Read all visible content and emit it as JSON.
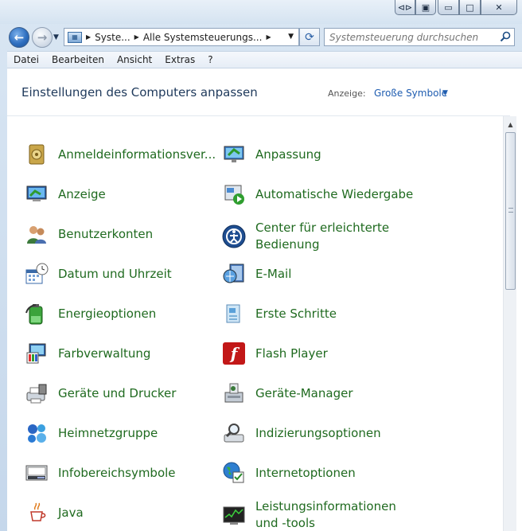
{
  "window": {
    "caption_buttons": [
      {
        "name": "minimize",
        "glyph": "▭"
      },
      {
        "name": "maximize",
        "glyph": "□"
      },
      {
        "name": "close",
        "glyph": "✕"
      }
    ],
    "extra_buttons": [
      "⊲⊳",
      "▣"
    ]
  },
  "nav": {
    "back_glyph": "←",
    "forward_glyph": "→",
    "breadcrumb": [
      "Syste...",
      "Alle Systemsteuerungs..."
    ],
    "refresh_glyph": "⟳",
    "search": {
      "placeholder": "Systemsteuerung durchsuchen"
    }
  },
  "menu": [
    "Datei",
    "Bearbeiten",
    "Ansicht",
    "Extras",
    "?"
  ],
  "header": {
    "title": "Einstellungen des Computers anpassen",
    "view_label": "Anzeige:",
    "view_value": "Große Symbole"
  },
  "items": [
    {
      "label": "Anmeldeinformationsver...",
      "icon": "credential-manager-icon"
    },
    {
      "label": "Anpassung",
      "icon": "personalization-icon"
    },
    {
      "label": "Anzeige",
      "icon": "display-icon"
    },
    {
      "label": "Automatische Wiedergabe",
      "icon": "autoplay-icon"
    },
    {
      "label": "Benutzerkonten",
      "icon": "user-accounts-icon"
    },
    {
      "label": "Center für erleichterte Bedienung",
      "icon": "ease-of-access-icon"
    },
    {
      "label": "Datum und Uhrzeit",
      "icon": "date-time-icon"
    },
    {
      "label": "E-Mail",
      "icon": "mail-icon"
    },
    {
      "label": "Energieoptionen",
      "icon": "power-options-icon"
    },
    {
      "label": "Erste Schritte",
      "icon": "getting-started-icon"
    },
    {
      "label": "Farbverwaltung",
      "icon": "color-management-icon"
    },
    {
      "label": "Flash Player",
      "icon": "flash-player-icon"
    },
    {
      "label": "Geräte und Drucker",
      "icon": "devices-printers-icon"
    },
    {
      "label": "Geräte-Manager",
      "icon": "device-manager-icon"
    },
    {
      "label": "Heimnetzgruppe",
      "icon": "homegroup-icon"
    },
    {
      "label": "Indizierungsoptionen",
      "icon": "indexing-options-icon"
    },
    {
      "label": "Infobereichsymbole",
      "icon": "notification-area-icon"
    },
    {
      "label": "Internetoptionen",
      "icon": "internet-options-icon"
    },
    {
      "label": "Java",
      "icon": "java-icon"
    },
    {
      "label": "Leistungsinformationen und -tools",
      "icon": "performance-info-icon"
    }
  ],
  "colors": {
    "link_green": "#1f6a1f",
    "title_blue": "#1e395b",
    "accent_blue": "#1e5cb0"
  }
}
